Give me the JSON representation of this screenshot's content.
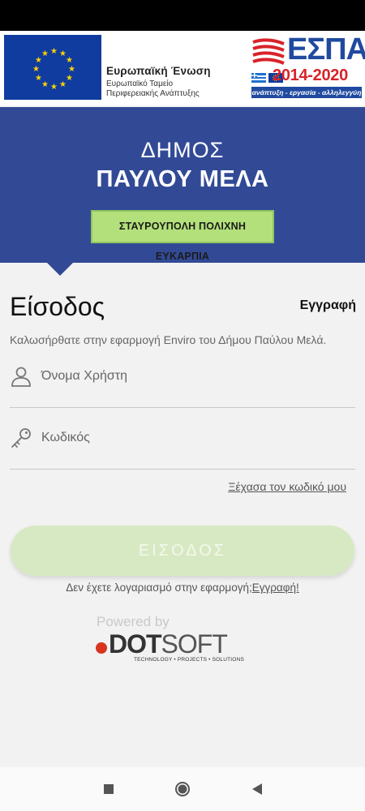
{
  "eu_banner": {
    "title": "Ευρωπαϊκή Ένωση",
    "subtitle_line1": "Ευρωπαϊκό Ταμείο",
    "subtitle_line2": "Περιφερειακής Ανάπτυξης"
  },
  "espa": {
    "word": "ΕΣΠΑ",
    "years": "2014-2020",
    "tagline": "ανάπτυξη - εργασία - αλληλεγγύη"
  },
  "hero": {
    "line1": "ΔΗΜΟΣ",
    "line2": "ΠΑΥΛΟΥ ΜΕΛΑ",
    "badge": "ΣΤΑΥΡΟΥΠΟΛΗ ΠΟΛΙΧΝΗ ΕΥΚΑΡΠΙΑ"
  },
  "login": {
    "title": "Είσοδος",
    "register_link": "Εγγραφή",
    "welcome": "Καλωσήρθατε στην εφαρμογή Enviro του Δήμου Παύλου Μελά.",
    "username_placeholder": "Όνομα Χρήστη",
    "password_placeholder": "Κωδικός",
    "forgot": "Ξέχασα τον κωδικό μου",
    "button": "ΕΙΣΟΔΟΣ",
    "no_account": "Δεν έχετε λογαριασμό στην εφαρμογή;",
    "no_account_link": "Εγγραφή!"
  },
  "footer": {
    "powered_by": "Powered by",
    "logo_word": "DOT",
    "logo_word2": "SOFT",
    "logo_tagline": "TECHNOLOGY • PROJECTS • SOLUTIONS"
  },
  "colors": {
    "hero_bg": "#324a96",
    "badge_bg": "#b3e07a",
    "button_bg": "#d7e9c2",
    "espa_blue": "#1f4aa0",
    "espa_red": "#d8232a"
  },
  "icons": {
    "username": "person-icon",
    "password": "key-icon",
    "nav_recents": "square-icon",
    "nav_home": "circle-icon",
    "nav_back": "triangle-back-icon"
  }
}
